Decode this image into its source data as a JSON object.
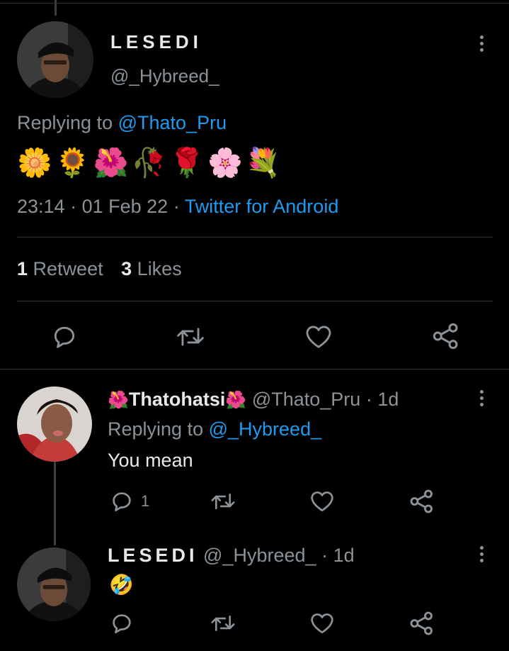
{
  "main_tweet": {
    "display_name": "LESEDI",
    "handle": "@_Hybreed_",
    "replying_prefix": "Replying to",
    "replying_to": "@Thato_Pru",
    "emojis": "🌼🌻🌺🥀🌹🌸💐",
    "time": "23:14",
    "separator": "·",
    "date": "01 Feb 22",
    "source": "Twitter for Android",
    "retweet_count": "1",
    "retweet_label": "Retweet",
    "like_count": "3",
    "like_label": "Likes"
  },
  "replies": [
    {
      "flower_left": "🌺",
      "display_name": "Thatohatsi",
      "flower_right": "🌺",
      "handle": "@Thato_Pru",
      "time": "1d",
      "replying_prefix": "Replying to",
      "replying_to": "@_Hybreed_",
      "text": "You mean",
      "reply_count": "1"
    },
    {
      "display_name": "LESEDI",
      "handle": "@_Hybreed_",
      "time": "1d",
      "text": "🤣"
    }
  ],
  "colors": {
    "background": "#000000",
    "text": "#e7e9ea",
    "muted": "#8b9298",
    "link": "#1d9bf0",
    "divider": "#2f3336"
  },
  "icons": [
    "reply-icon",
    "retweet-icon",
    "like-icon",
    "share-icon",
    "more-icon"
  ]
}
